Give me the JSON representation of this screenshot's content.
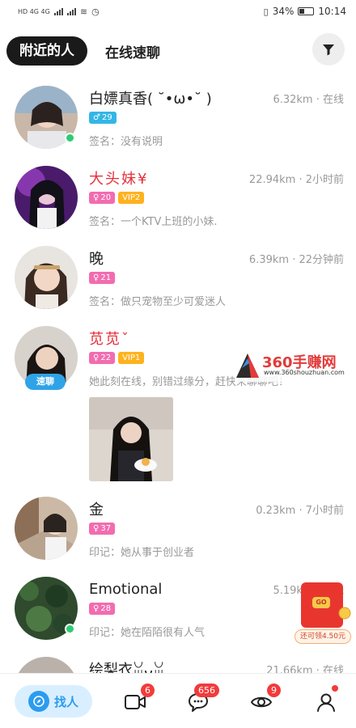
{
  "status_bar": {
    "left": "HD 4G 4G",
    "battery": "34%",
    "time": "10:14"
  },
  "header": {
    "tab_active": "附近的人",
    "tab_2": "在线速聊"
  },
  "users": [
    {
      "name": "白嫖真香( ˘•ω•˘ )",
      "name_color": "#222222",
      "distance": "6.32km · 在线",
      "gender": "male",
      "age": "29",
      "vip": "",
      "sign": "签名：没有说明",
      "online": true
    },
    {
      "name": "大头妹¥",
      "name_color": "#e5303a",
      "distance": "22.94km · 2小时前",
      "gender": "female",
      "age": "20",
      "vip": "VIP2",
      "sign": "签名：一个KTV上班的小妹.",
      "online": false
    },
    {
      "name": "晚",
      "name_color": "#222222",
      "distance": "6.39km · 22分钟前",
      "gender": "female",
      "age": "21",
      "vip": "",
      "sign": "签名：做只宠物至少可爱迷人",
      "online": false
    },
    {
      "name": "苋苋ˇ",
      "name_color": "#e5303a",
      "distance": "",
      "gender": "female",
      "age": "22",
      "vip": "VIP1",
      "sign": "她此刻在线，别错过缘分，赶快来聊聊吧！",
      "speed_chip": "速聊",
      "online": false
    },
    {
      "name": "金",
      "name_color": "#222222",
      "distance": "0.23km · 7小时前",
      "gender": "female",
      "age": "37",
      "vip": "",
      "sign": "印记：她从事于创业者",
      "online": false
    },
    {
      "name": "Emotional",
      "name_color": "#222222",
      "distance": "5.19km · 在线",
      "gender": "female",
      "age": "28",
      "vip": "",
      "sign": "印记：她在陌陌很有人气",
      "online": true
    },
    {
      "name": "绘梨衣ꈍᴗꈍ",
      "name_color": "#222222",
      "distance": "21.66km · 在线",
      "gender": "female",
      "age": "",
      "vip": "",
      "sign": "",
      "online": false
    }
  ],
  "watermark": {
    "title": "360手赚网",
    "url": "www.360shouzhuan.com"
  },
  "envelope": {
    "go": "GO",
    "label": "还可领4.50元"
  },
  "bottom_nav": {
    "find_label": "找人",
    "video_badge": "6",
    "message_badge": "656",
    "visitors_badge": "9"
  },
  "colors": {
    "accent": "#2b9cf0",
    "badge_red": "#f23b3b",
    "vip": "#ffb21e",
    "female": "#f26cb0",
    "male": "#33b6e6"
  }
}
